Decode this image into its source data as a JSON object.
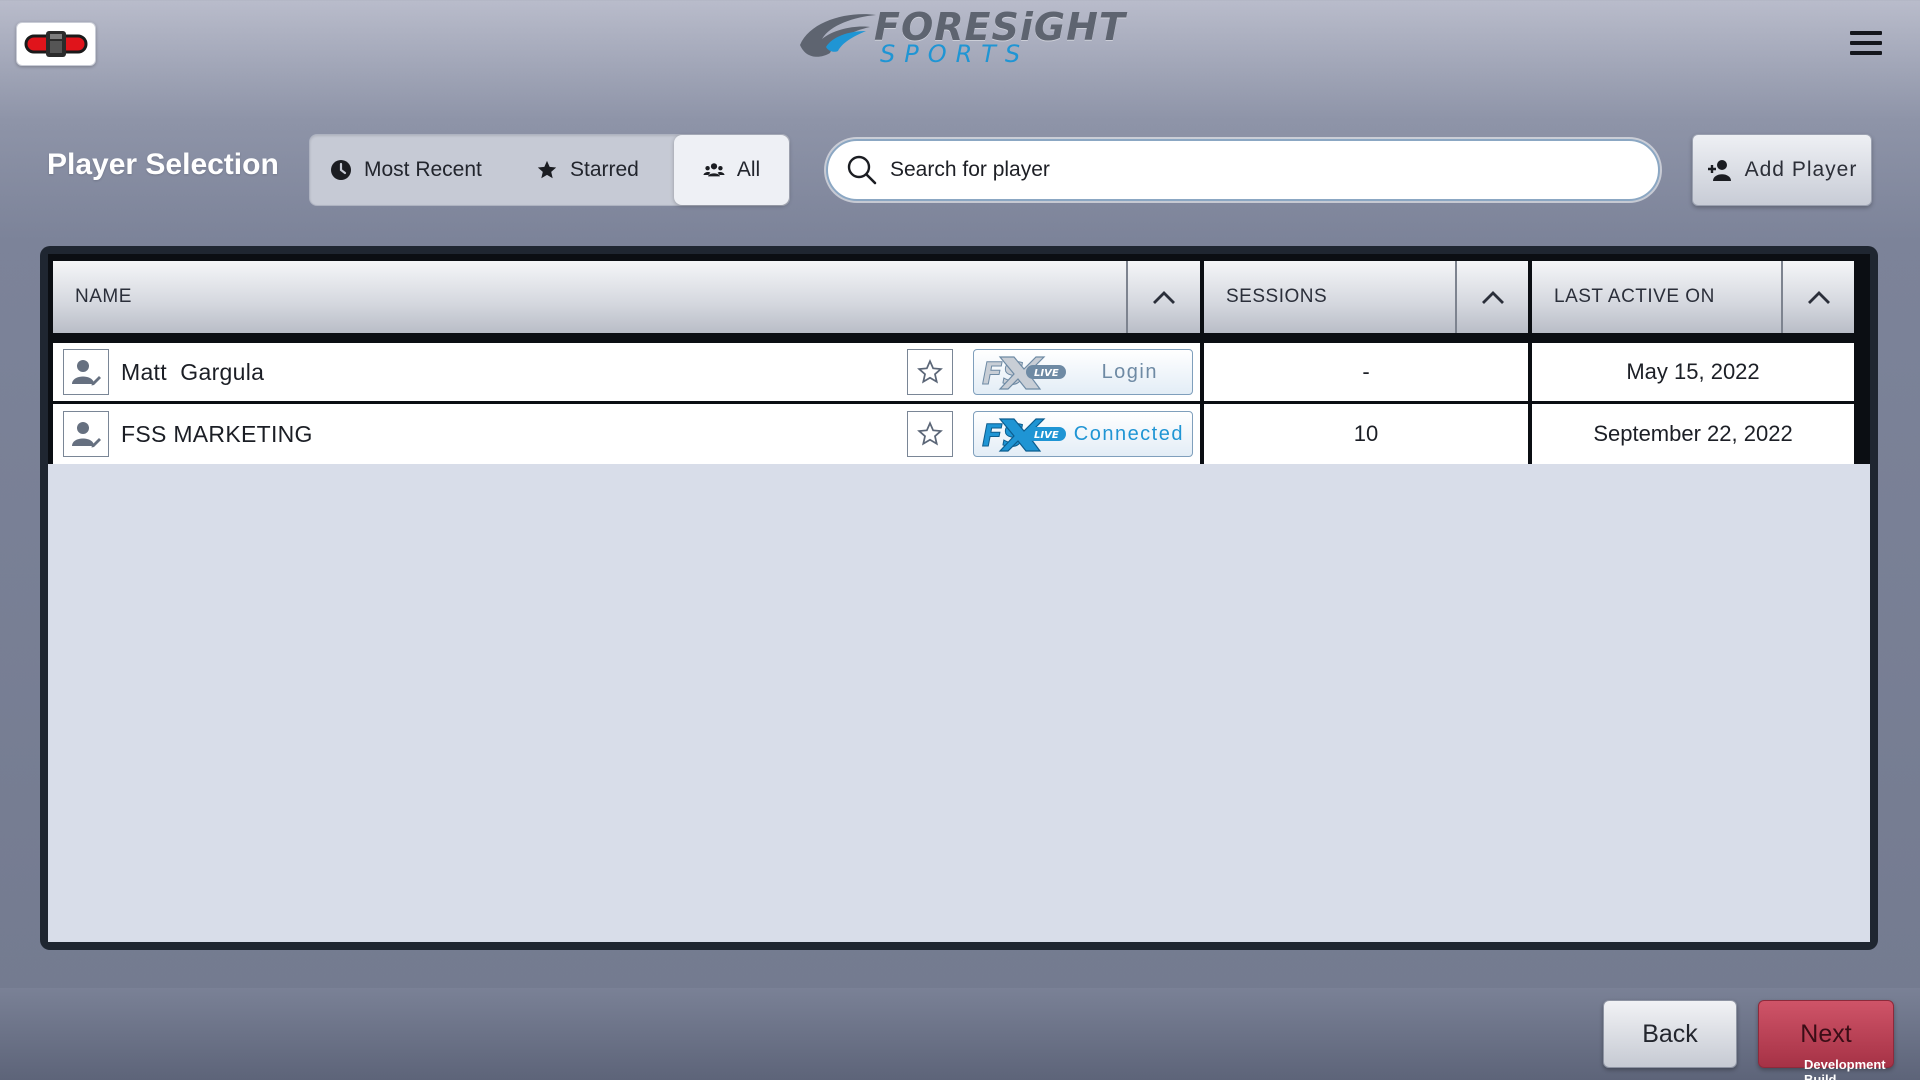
{
  "header": {
    "logo_top": "FORESiGHT",
    "logo_bottom": "SPORTS"
  },
  "toolbar": {
    "title": "Player Selection",
    "filters": [
      {
        "label": "Most Recent",
        "icon": "clock-icon"
      },
      {
        "label": "Starred",
        "icon": "star-icon"
      },
      {
        "label": "All",
        "icon": "users-icon",
        "selected": true
      }
    ],
    "search_placeholder": "Search for player",
    "add_player_label": "Add Player"
  },
  "table": {
    "columns": [
      "NAME",
      "SESSIONS",
      "LAST ACTIVE ON"
    ],
    "rows": [
      {
        "name": "Matt  Gargula",
        "fslive_status": "Login",
        "sessions": "-",
        "last_active": "May 15, 2022"
      },
      {
        "name": "FSS MARKETING",
        "fslive_status": "Connected",
        "sessions": "10",
        "last_active": "September 22, 2022"
      }
    ],
    "badge_text": "LIVE"
  },
  "footer": {
    "back_label": "Back",
    "next_label": "Next",
    "build_label": "Development Build"
  },
  "colors": {
    "accent_blue": "#1f95d4",
    "next_red": "#bf4358",
    "panel_dark": "#1f2631"
  }
}
